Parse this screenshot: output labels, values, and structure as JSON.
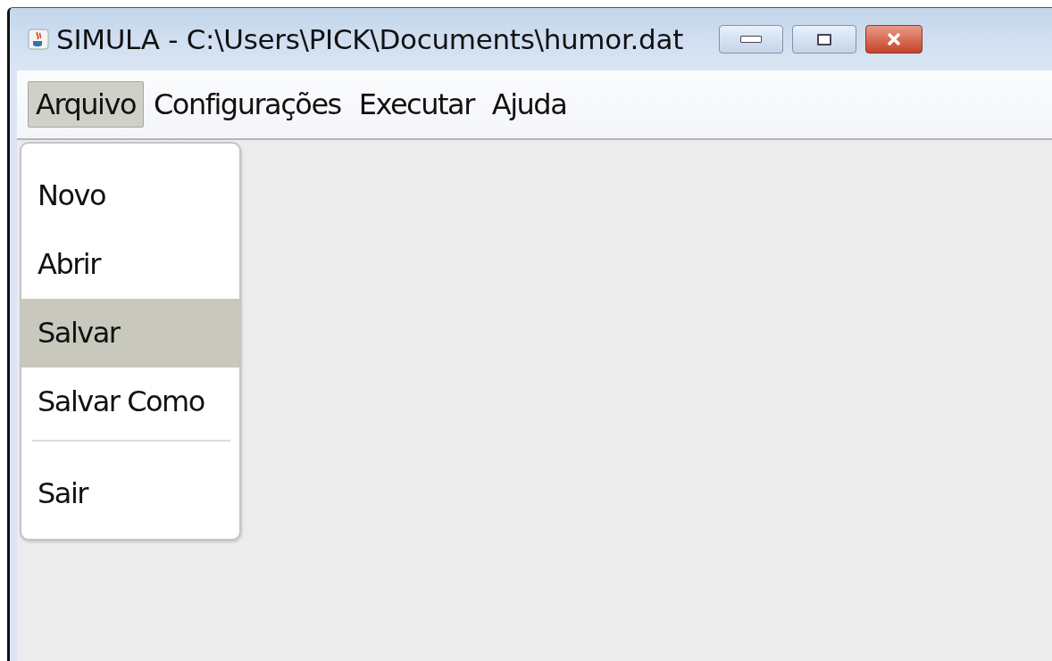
{
  "window": {
    "title": "SIMULA - C:\\Users\\PICK\\Documents\\humor.dat"
  },
  "menu_bar": [
    {
      "label": "Arquivo",
      "selected": true
    },
    {
      "label": "Configurações",
      "selected": false
    },
    {
      "label": "Executar",
      "selected": false
    },
    {
      "label": "Ajuda",
      "selected": false
    }
  ],
  "dropdown_menu": [
    {
      "kind": "item",
      "label": "Novo",
      "selected": false
    },
    {
      "kind": "item",
      "label": "Abrir",
      "selected": false
    },
    {
      "kind": "item",
      "label": "Salvar",
      "selected": true
    },
    {
      "kind": "item",
      "label": "Salvar Como",
      "selected": false
    },
    {
      "kind": "separator"
    },
    {
      "kind": "item",
      "label": "Sair",
      "selected": false
    }
  ]
}
